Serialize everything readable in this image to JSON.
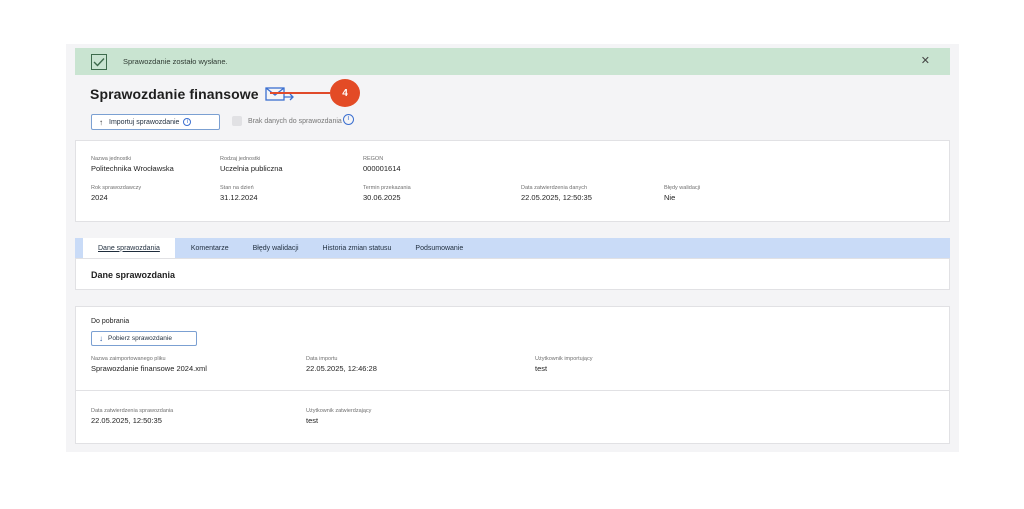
{
  "banner": {
    "message": "Sprawozdanie zostało wysłane.",
    "close_icon": "close-icon",
    "check_icon": "checkbox-checked-icon"
  },
  "header": {
    "title": "Sprawozdanie finansowe",
    "mail_icon": "send-mail-icon",
    "callout_number": "4"
  },
  "actions": {
    "import_label": "Importuj sprawozdanie",
    "no_data_label": "Brak danych do sprawozdania"
  },
  "info": {
    "unit_name_label": "Nazwa jednostki",
    "unit_name": "Politechnika Wrocławska",
    "unit_type_label": "Rodzaj jednostki",
    "unit_type": "Uczelnia publiczna",
    "regon_label": "REGON",
    "regon": "000001614",
    "year_label": "Rok sprawozdawczy",
    "year": "2024",
    "state_label": "Stan na dzień",
    "state": "31.12.2024",
    "deadline_label": "Termin przekazania",
    "deadline": "30.06.2025",
    "approved_label": "Data zatwierdzenia danych",
    "approved": "22.05.2025, 12:50:35",
    "errors_label": "Błędy walidacji",
    "errors": "Nie"
  },
  "tabs": [
    {
      "label": "Dane sprawozdania"
    },
    {
      "label": "Komentarze"
    },
    {
      "label": "Błędy walidacji"
    },
    {
      "label": "Historia zmian statusu"
    },
    {
      "label": "Podsumowanie"
    }
  ],
  "section_title": "Dane sprawozdania",
  "download": {
    "heading": "Do pobrania",
    "button_label": "Pobierz sprawozdanie",
    "file_label": "Nazwa zaimportowanego pliku",
    "file": "Sprawozdanie finansowe 2024.xml",
    "import_date_label": "Data importu",
    "import_date": "22.05.2025, 12:46:28",
    "import_user_label": "Użytkownik importujący",
    "import_user": "test",
    "approve_date_label": "Data zatwierdzenia sprawozdania",
    "approve_date": "22.05.2025, 12:50:35",
    "approve_user_label": "Użytkownik zatwierdzający",
    "approve_user": "test"
  },
  "colors": {
    "banner": "#c9e4d1",
    "tabs": "#c9dbf7",
    "callout": "#e34b26",
    "accent": "#3b6fd0"
  }
}
